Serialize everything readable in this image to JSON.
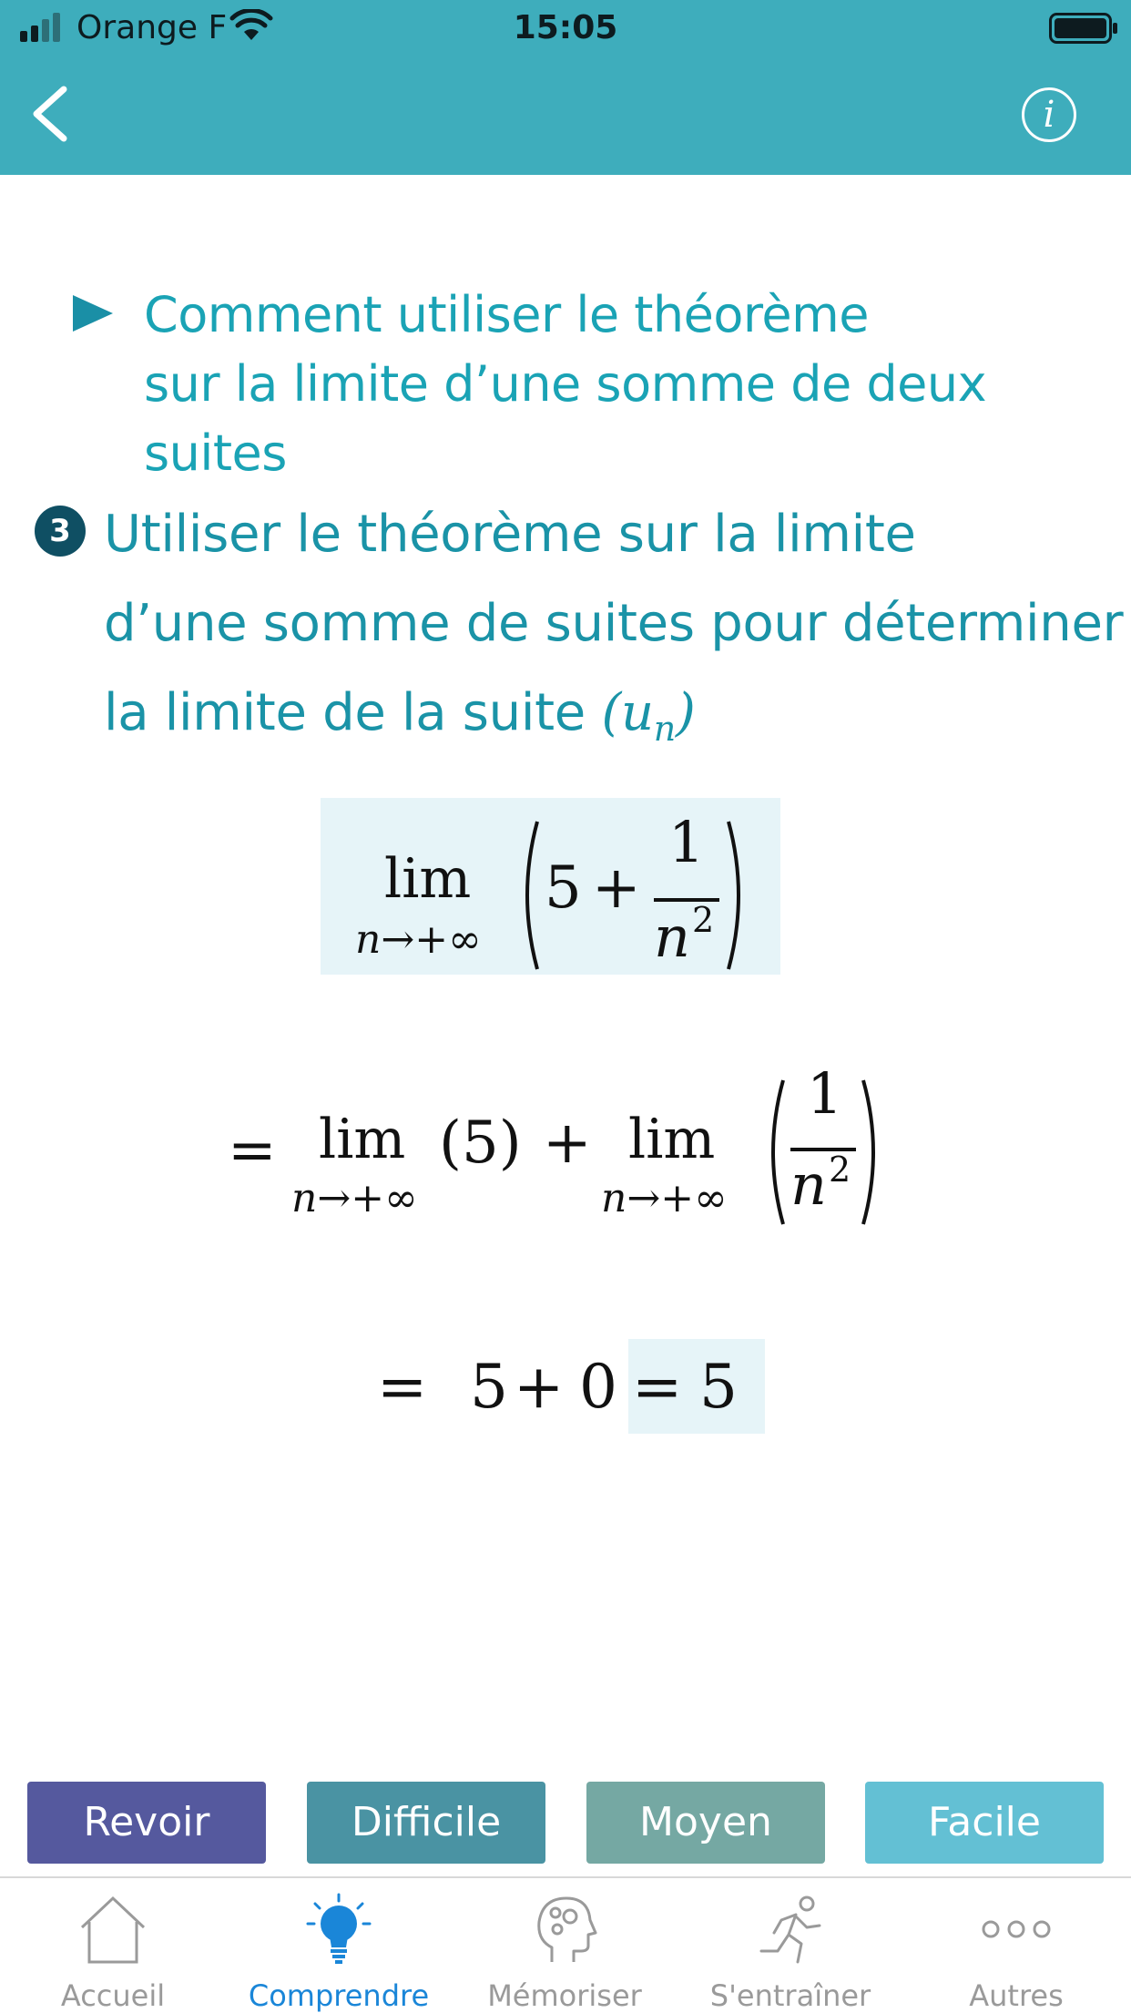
{
  "status_bar": {
    "carrier": "Orange F",
    "time": "15:05"
  },
  "nav": {
    "back_icon": "chevron-left-icon",
    "info_icon": "info-icon",
    "info_glyph": "i"
  },
  "section": {
    "line1": "Comment utiliser le théorème",
    "line2": "sur la limite d’une somme de deux suites"
  },
  "step": {
    "number": "3",
    "line1": "Utiliser le théorème sur la limite",
    "line2": "d’une somme de suites pour déterminer",
    "line3": "la limite de la suite",
    "sequence": "(u",
    "sequence_sub": "n",
    "sequence_close": ")"
  },
  "formula": {
    "lim": "lim",
    "lim_sub": "n→+∞",
    "five": "5",
    "plus": "+",
    "one": "1",
    "n": "n",
    "sq": "2",
    "eq": "=",
    "five_paren": "(5)",
    "zero": "0",
    "result": "5"
  },
  "buttons": {
    "revoir": "Revoir",
    "difficile": "Difficile",
    "moyen": "Moyen",
    "facile": "Facile"
  },
  "tabs": [
    {
      "label": "Accueil",
      "icon": "home-icon"
    },
    {
      "label": "Comprendre",
      "icon": "lightbulb-icon"
    },
    {
      "label": "Mémoriser",
      "icon": "brain-icon"
    },
    {
      "label": "S'entraîner",
      "icon": "runner-icon"
    },
    {
      "label": "Autres",
      "icon": "more-icon"
    }
  ],
  "colors": {
    "header": "#3eadbc",
    "active_tab": "#1a86d8",
    "title": "#1aa3b5"
  }
}
